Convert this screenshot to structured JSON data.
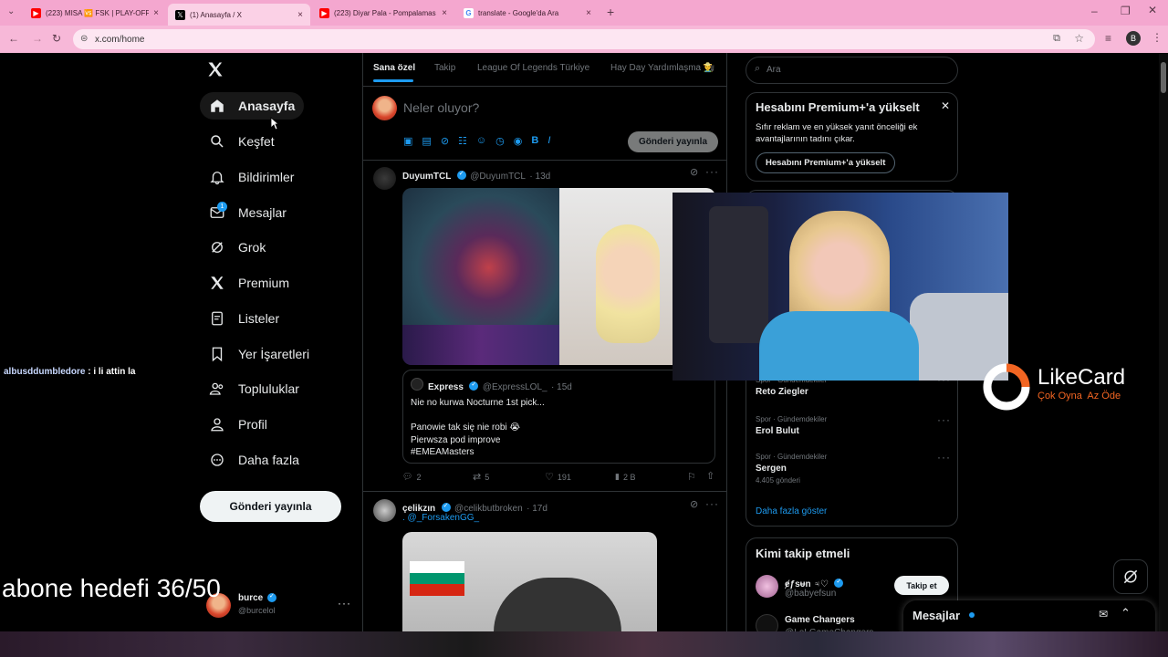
{
  "browser": {
    "tabs": [
      {
        "title": "(223) MISA 🆚 FSK | PLAY-OFF",
        "favicon": "youtube-icon",
        "color": "#ff0000"
      },
      {
        "title": "(1) Anasayfa / X",
        "favicon": "x-icon",
        "color": "#000000"
      },
      {
        "title": "(223) Diyar Pala - Pompalamas",
        "favicon": "youtube-icon",
        "color": "#ff0000"
      },
      {
        "title": "translate - Google'da Ara",
        "favicon": "google-icon",
        "color": "#4285f4"
      }
    ],
    "url": "x.com/home",
    "profile_initial": "B"
  },
  "nav": {
    "items": [
      {
        "label": "Anasayfa",
        "icon": "home-icon"
      },
      {
        "label": "Keşfet",
        "icon": "search-icon"
      },
      {
        "label": "Bildirimler",
        "icon": "bell-icon"
      },
      {
        "label": "Mesajlar",
        "icon": "mail-icon"
      },
      {
        "label": "Grok",
        "icon": "grok-icon"
      },
      {
        "label": "Premium",
        "icon": "x-icon"
      },
      {
        "label": "Listeler",
        "icon": "list-icon"
      },
      {
        "label": "Yer İşaretleri",
        "icon": "bookmark-icon"
      },
      {
        "label": "Topluluklar",
        "icon": "people-icon"
      },
      {
        "label": "Profil",
        "icon": "person-icon"
      },
      {
        "label": "Daha fazla",
        "icon": "more-icon"
      }
    ],
    "messages_badge": "1",
    "post_button": "Gönderi yayınla",
    "account": {
      "name": "burce",
      "handle": "@burcelol"
    }
  },
  "feed": {
    "tabs": [
      "Sana özel",
      "Takip",
      "League Of Legends Türkiye",
      "Hay Day Yardımlaşma 👨‍🌾"
    ],
    "compose_placeholder": "Neler oluyor?",
    "compose_button": "Gönderi yayınla",
    "tweets": [
      {
        "name": "DuyumTCL",
        "handle": "@DuyumTCL",
        "time": "· 13d",
        "quote": {
          "name": "Express",
          "handle": "@ExpressLOL_",
          "time": "· 15d",
          "lines": [
            "Nie no kurwa Nocturne 1st pick...",
            "",
            "Panowie tak się nie robi 😭",
            "Pierwsza pod improve",
            "#EMEAMasters"
          ]
        },
        "replies": "2",
        "reposts": "5",
        "likes": "191",
        "views": "2 B"
      },
      {
        "name": "çelikzın",
        "handle": "@celikbutbroken",
        "time": "· 17d",
        "text": ". @_ForsakenGG_"
      }
    ]
  },
  "sidebar": {
    "search_placeholder": "Ara",
    "premium": {
      "title": "Hesabını Premium+'a yükselt",
      "body": "Sıfır reklam ve en yüksek yanıt önceliği ek avantajlarının tadını çıkar.",
      "button": "Hesabını Premium+'a yükselt"
    },
    "trends": [
      {
        "category": "Spor · Gündemdekiler",
        "name": "Reto Ziegler",
        "count": ""
      },
      {
        "category": "Spor · Gündemdekiler",
        "name": "Erol Bulut",
        "count": ""
      },
      {
        "category": "Spor · Gündemdekiler",
        "name": "Sergen",
        "count": "4.405 gönderi"
      }
    ],
    "show_more": "Daha fazla göster",
    "who_to_follow": {
      "title": "Kimi takip etmeli",
      "users": [
        {
          "name": "ɇƒsᵾn ♃♡",
          "handle": "@babyefsun",
          "button": "Takip et"
        },
        {
          "name": "Game Changers",
          "handle": "@LoLGameChangers",
          "button": ""
        }
      ]
    }
  },
  "messages_drawer": {
    "title": "Mesajlar"
  },
  "stream_overlay": {
    "chat_user": "albusddumbledore",
    "chat_message": ": i li attin la",
    "goal_text": "abone hedefi 36/50",
    "sponsor_name": "LikeCard",
    "sponsor_tagline": "Çok Oyna  Az Öde",
    "colors": {
      "sponsor_orange": "#f26522"
    }
  }
}
